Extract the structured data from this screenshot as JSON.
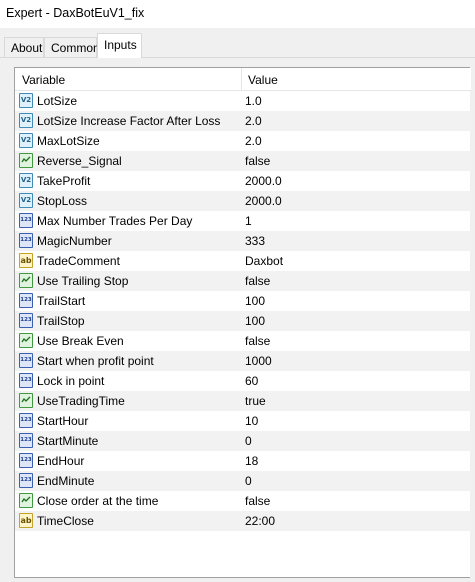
{
  "window": {
    "title": "Expert - DaxBotEuV1_fix"
  },
  "tabs": [
    {
      "label": "About",
      "active": false
    },
    {
      "label": "Common",
      "active": false
    },
    {
      "label": "Inputs",
      "active": true
    }
  ],
  "columns": {
    "variable": "Variable",
    "value": "Value"
  },
  "icon_types": {
    "double": {
      "text": "V2",
      "color": "#3f8bb5"
    },
    "bool": {
      "text": "",
      "color": "#3f9a3f"
    },
    "int": {
      "text": "123",
      "color": "#3a5fb0"
    },
    "string": {
      "text": "ab",
      "color": "#c4a128"
    }
  },
  "rows": [
    {
      "type": "double",
      "name": "LotSize",
      "value": "1.0"
    },
    {
      "type": "double",
      "name": "LotSize Increase Factor After Loss",
      "value": "2.0"
    },
    {
      "type": "double",
      "name": "MaxLotSize",
      "value": "2.0"
    },
    {
      "type": "bool",
      "name": "Reverse_Signal",
      "value": "false"
    },
    {
      "type": "double",
      "name": "TakeProfit",
      "value": "2000.0"
    },
    {
      "type": "double",
      "name": "StopLoss",
      "value": "2000.0"
    },
    {
      "type": "int",
      "name": "Max Number Trades Per Day",
      "value": "1"
    },
    {
      "type": "int",
      "name": "MagicNumber",
      "value": "333"
    },
    {
      "type": "string",
      "name": "TradeComment",
      "value": "Daxbot"
    },
    {
      "type": "bool",
      "name": "Use Trailing Stop",
      "value": "false"
    },
    {
      "type": "int",
      "name": "TrailStart",
      "value": "100"
    },
    {
      "type": "int",
      "name": "TrailStop",
      "value": "100"
    },
    {
      "type": "bool",
      "name": "Use Break Even",
      "value": "false"
    },
    {
      "type": "int",
      "name": "Start when profit point",
      "value": "1000"
    },
    {
      "type": "int",
      "name": "Lock in point",
      "value": "60"
    },
    {
      "type": "bool",
      "name": "UseTradingTime",
      "value": "true"
    },
    {
      "type": "int",
      "name": "StartHour",
      "value": "10"
    },
    {
      "type": "int",
      "name": "StartMinute",
      "value": "0"
    },
    {
      "type": "int",
      "name": "EndHour",
      "value": "18"
    },
    {
      "type": "int",
      "name": "EndMinute",
      "value": "0"
    },
    {
      "type": "bool",
      "name": "Close order at the time",
      "value": "false"
    },
    {
      "type": "string",
      "name": "TimeClose",
      "value": "22:00"
    }
  ]
}
